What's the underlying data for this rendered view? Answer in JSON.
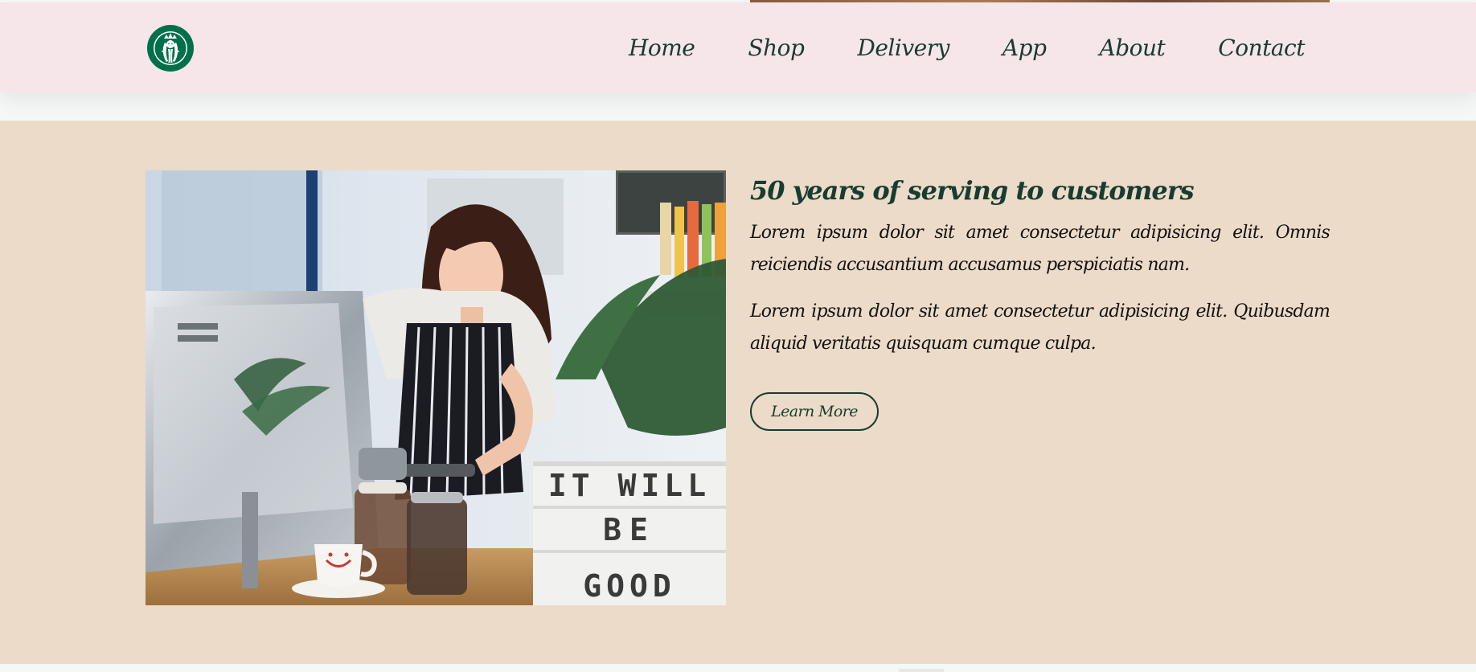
{
  "brand": {
    "logo_icon": "starbucks-siren-logo",
    "logo_color": "#00704a"
  },
  "nav": {
    "items": [
      {
        "label": "Home"
      },
      {
        "label": "Shop"
      },
      {
        "label": "Delivery"
      },
      {
        "label": "App"
      },
      {
        "label": "About"
      },
      {
        "label": "Contact"
      }
    ]
  },
  "about": {
    "image_icon": "barista-photo",
    "lightbox_text": [
      "IT WILL",
      "BE",
      "GOOD"
    ],
    "heading": "50 years of serving to customers",
    "paragraphs": [
      "Lorem ipsum dolor sit amet consectetur adipisicing elit. Omnis reiciendis accusantium accusamus perspiciatis nam.",
      "Lorem ipsum dolor sit amet consectetur adipisicing elit. Quibusdam aliquid veritatis quisquam cumque culpa."
    ],
    "button_label": "Learn More"
  },
  "colors": {
    "navbar_bg": "#f6e6ea",
    "section_bg": "#ecdbc8",
    "accent_green": "#173c31"
  }
}
